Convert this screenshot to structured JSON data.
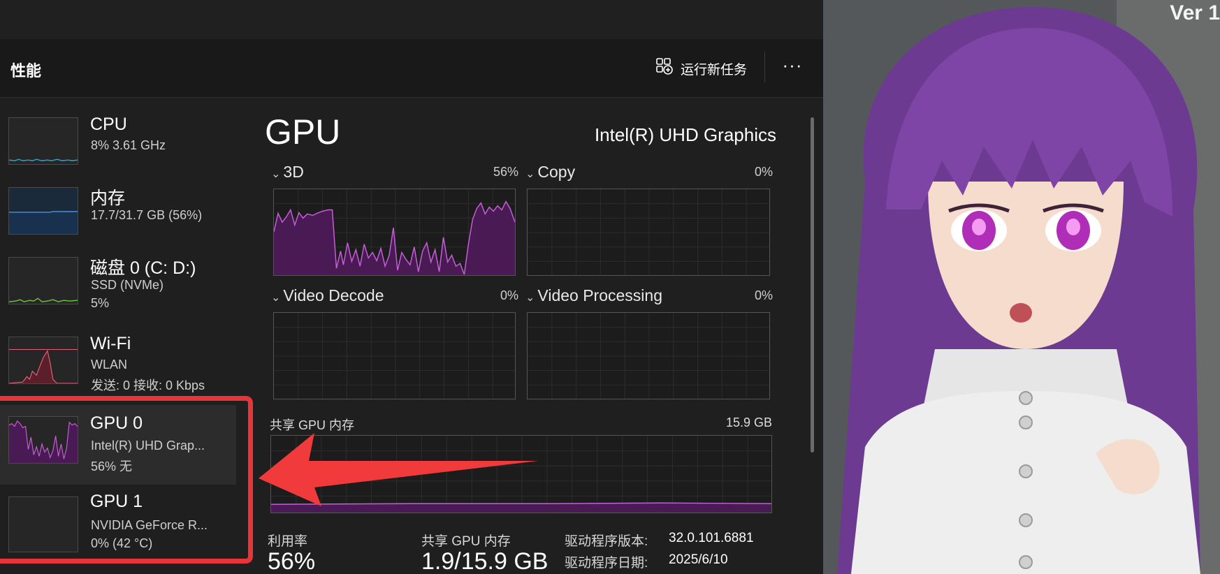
{
  "header": {
    "title": "性能",
    "run_task_label": "运行新任务",
    "more_label": "···"
  },
  "sidebar": {
    "items": [
      {
        "title": "CPU",
        "line1": "8%  3.61 GHz",
        "line2": ""
      },
      {
        "title": "内存",
        "line1": "17.7/31.7 GB (56%)",
        "line2": ""
      },
      {
        "title": "磁盘 0 (C: D:)",
        "line1": "SSD (NVMe)",
        "line2": "5%"
      },
      {
        "title": "Wi-Fi",
        "line1": "WLAN",
        "line2": "发送: 0 接收: 0 Kbps"
      },
      {
        "title": "GPU 0",
        "line1": "Intel(R) UHD Grap...",
        "line2": "56%  无"
      },
      {
        "title": "GPU 1",
        "line1": "NVIDIA GeForce R...",
        "line2": "0% (42 °C)"
      }
    ]
  },
  "main": {
    "title": "GPU",
    "model": "Intel(R) UHD Graphics",
    "engines": [
      {
        "name": "3D",
        "percent": "56%"
      },
      {
        "name": "Copy",
        "percent": "0%"
      },
      {
        "name": "Video Decode",
        "percent": "0%"
      },
      {
        "name": "Video Processing",
        "percent": "0%"
      }
    ],
    "shared_memory": {
      "label": "共享 GPU 内存",
      "max": "15.9 GB"
    },
    "stats": {
      "utilization_label": "利用率",
      "utilization_value": "56%",
      "shared_mem_label": "共享 GPU 内存",
      "shared_mem_value": "1.9/15.9 GB",
      "driver_version_label": "驱动程序版本:",
      "driver_version_value": "32.0.101.6881",
      "driver_date_label": "驱动程序日期:",
      "driver_date_value": "2025/6/10"
    }
  },
  "artwork": {
    "version_text": "Ver 1"
  },
  "colors": {
    "gpu_line": "#c45fd6",
    "gpu_fill": "#4a1a55",
    "cpu_line": "#2aa7d8",
    "memory_line": "#4b8fd6",
    "disk_line": "#6bbf3a",
    "wifi_line": "#e0607a",
    "highlight": "#e8353a"
  },
  "icons": {
    "run_task": "add-task-icon",
    "more": "more-icon",
    "chevron": "chevron-down-icon"
  }
}
